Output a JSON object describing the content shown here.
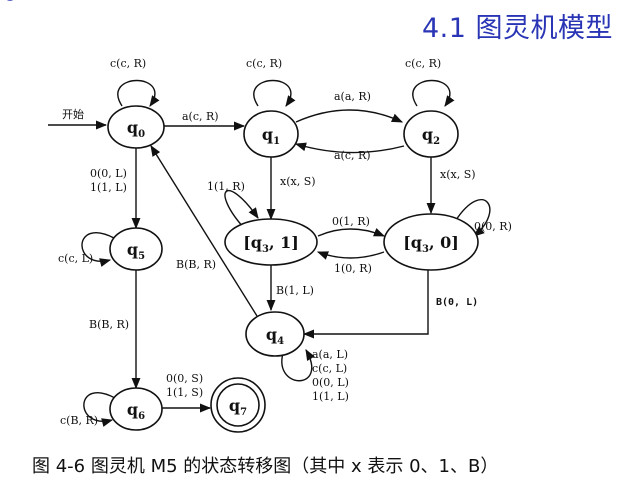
{
  "header": {
    "title": "4.1 图灵机模型"
  },
  "caption": "图 4-6 图灵机 M5 的状态转移图（其中 x 表示 0、1、B）",
  "diagram": {
    "start_label": "开始",
    "states": {
      "q0": {
        "base": "q",
        "sub": "0"
      },
      "q1": {
        "base": "q",
        "sub": "1"
      },
      "q2": {
        "base": "q",
        "sub": "2"
      },
      "q31": {
        "pre": "[q",
        "sub": "3",
        "post": ", 1]"
      },
      "q30": {
        "pre": "[q",
        "sub": "3",
        "post": ", 0]"
      },
      "q4": {
        "base": "q",
        "sub": "4"
      },
      "q5": {
        "base": "q",
        "sub": "5"
      },
      "q6": {
        "base": "q",
        "sub": "6"
      },
      "q7": {
        "base": "q",
        "sub": "7"
      }
    },
    "edges": {
      "q0_loop": "c(c, R)",
      "q1_loop": "c(c, R)",
      "q2_loop": "c(c, R)",
      "q0_q1": "a(c, R)",
      "q1_q2": "a(a, R)",
      "q2_q1": "a(c, R)",
      "q1_q31": "x(x, S)",
      "q2_q30": "x(x, S)",
      "q31_loop": "1(1, R)",
      "q30_loop": "0(0, R)",
      "q31_q30": "0(1, R)",
      "q30_q31": "1(0, R)",
      "q31_q4": "B(1, L)",
      "q30_q4": "B(0, L)",
      "q4_q0": "B(B, R)",
      "q4_loop": [
        "a(a, L)",
        "c(c, L)",
        "0(0, L)",
        "1(1, L)"
      ],
      "q0_q5": [
        "0(0, L)",
        "1(1, L)"
      ],
      "q5_loop": "c(c, L)",
      "q5_q6": "B(B, R)",
      "q6_loop": "c(B, R)",
      "q6_q7": [
        "0(0, S)",
        "1(1, S)"
      ]
    }
  }
}
